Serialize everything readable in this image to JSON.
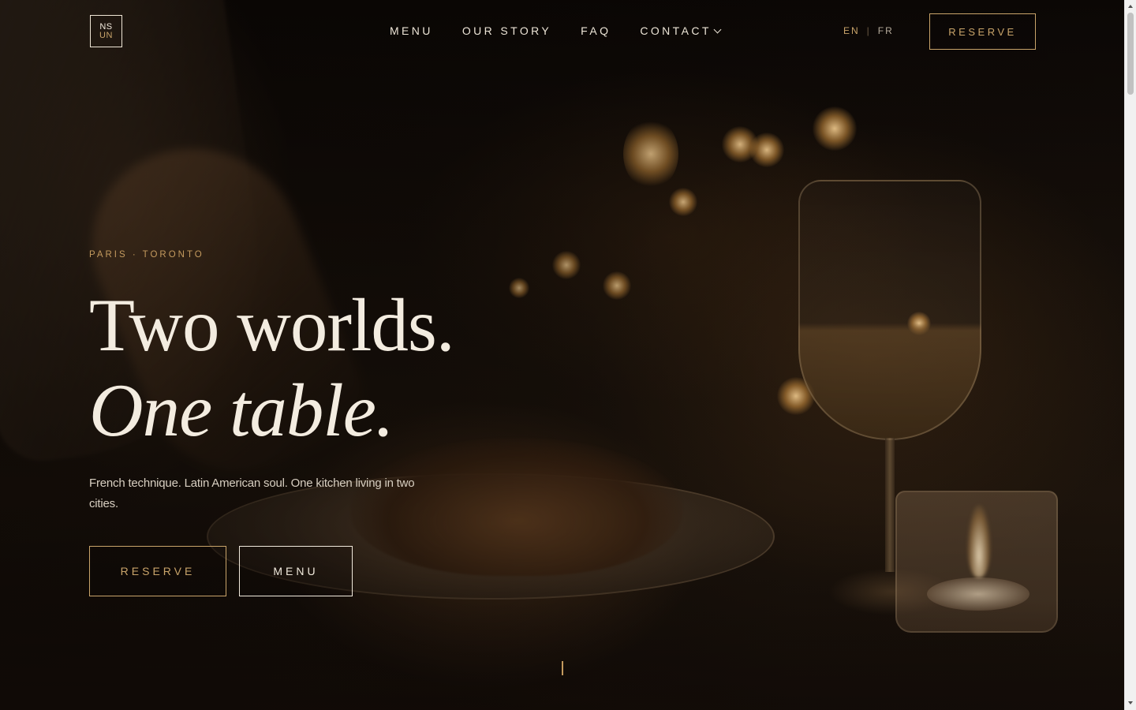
{
  "brand": {
    "logo_top": "NS",
    "logo_bottom": "UN",
    "accent_color": "#c9a46a",
    "text_color": "#f3ece0"
  },
  "nav": {
    "items": [
      {
        "label": "MENU"
      },
      {
        "label": "OUR STORY"
      },
      {
        "label": "FAQ"
      },
      {
        "label": "CONTACT",
        "icon": "chevron-down-icon"
      }
    ]
  },
  "language": {
    "en": "EN",
    "separator": "|",
    "fr": "FR",
    "active": "EN"
  },
  "header": {
    "reserve_label": "RESERVE"
  },
  "hero": {
    "eyebrow": "PARIS · TORONTO",
    "headline_line1": "Two worlds.",
    "headline_line2": "One table.",
    "subtext": "French technique. Latin American soul. One kitchen living in two cities.",
    "reserve_label": "RESERVE",
    "menu_label": "MENU"
  }
}
